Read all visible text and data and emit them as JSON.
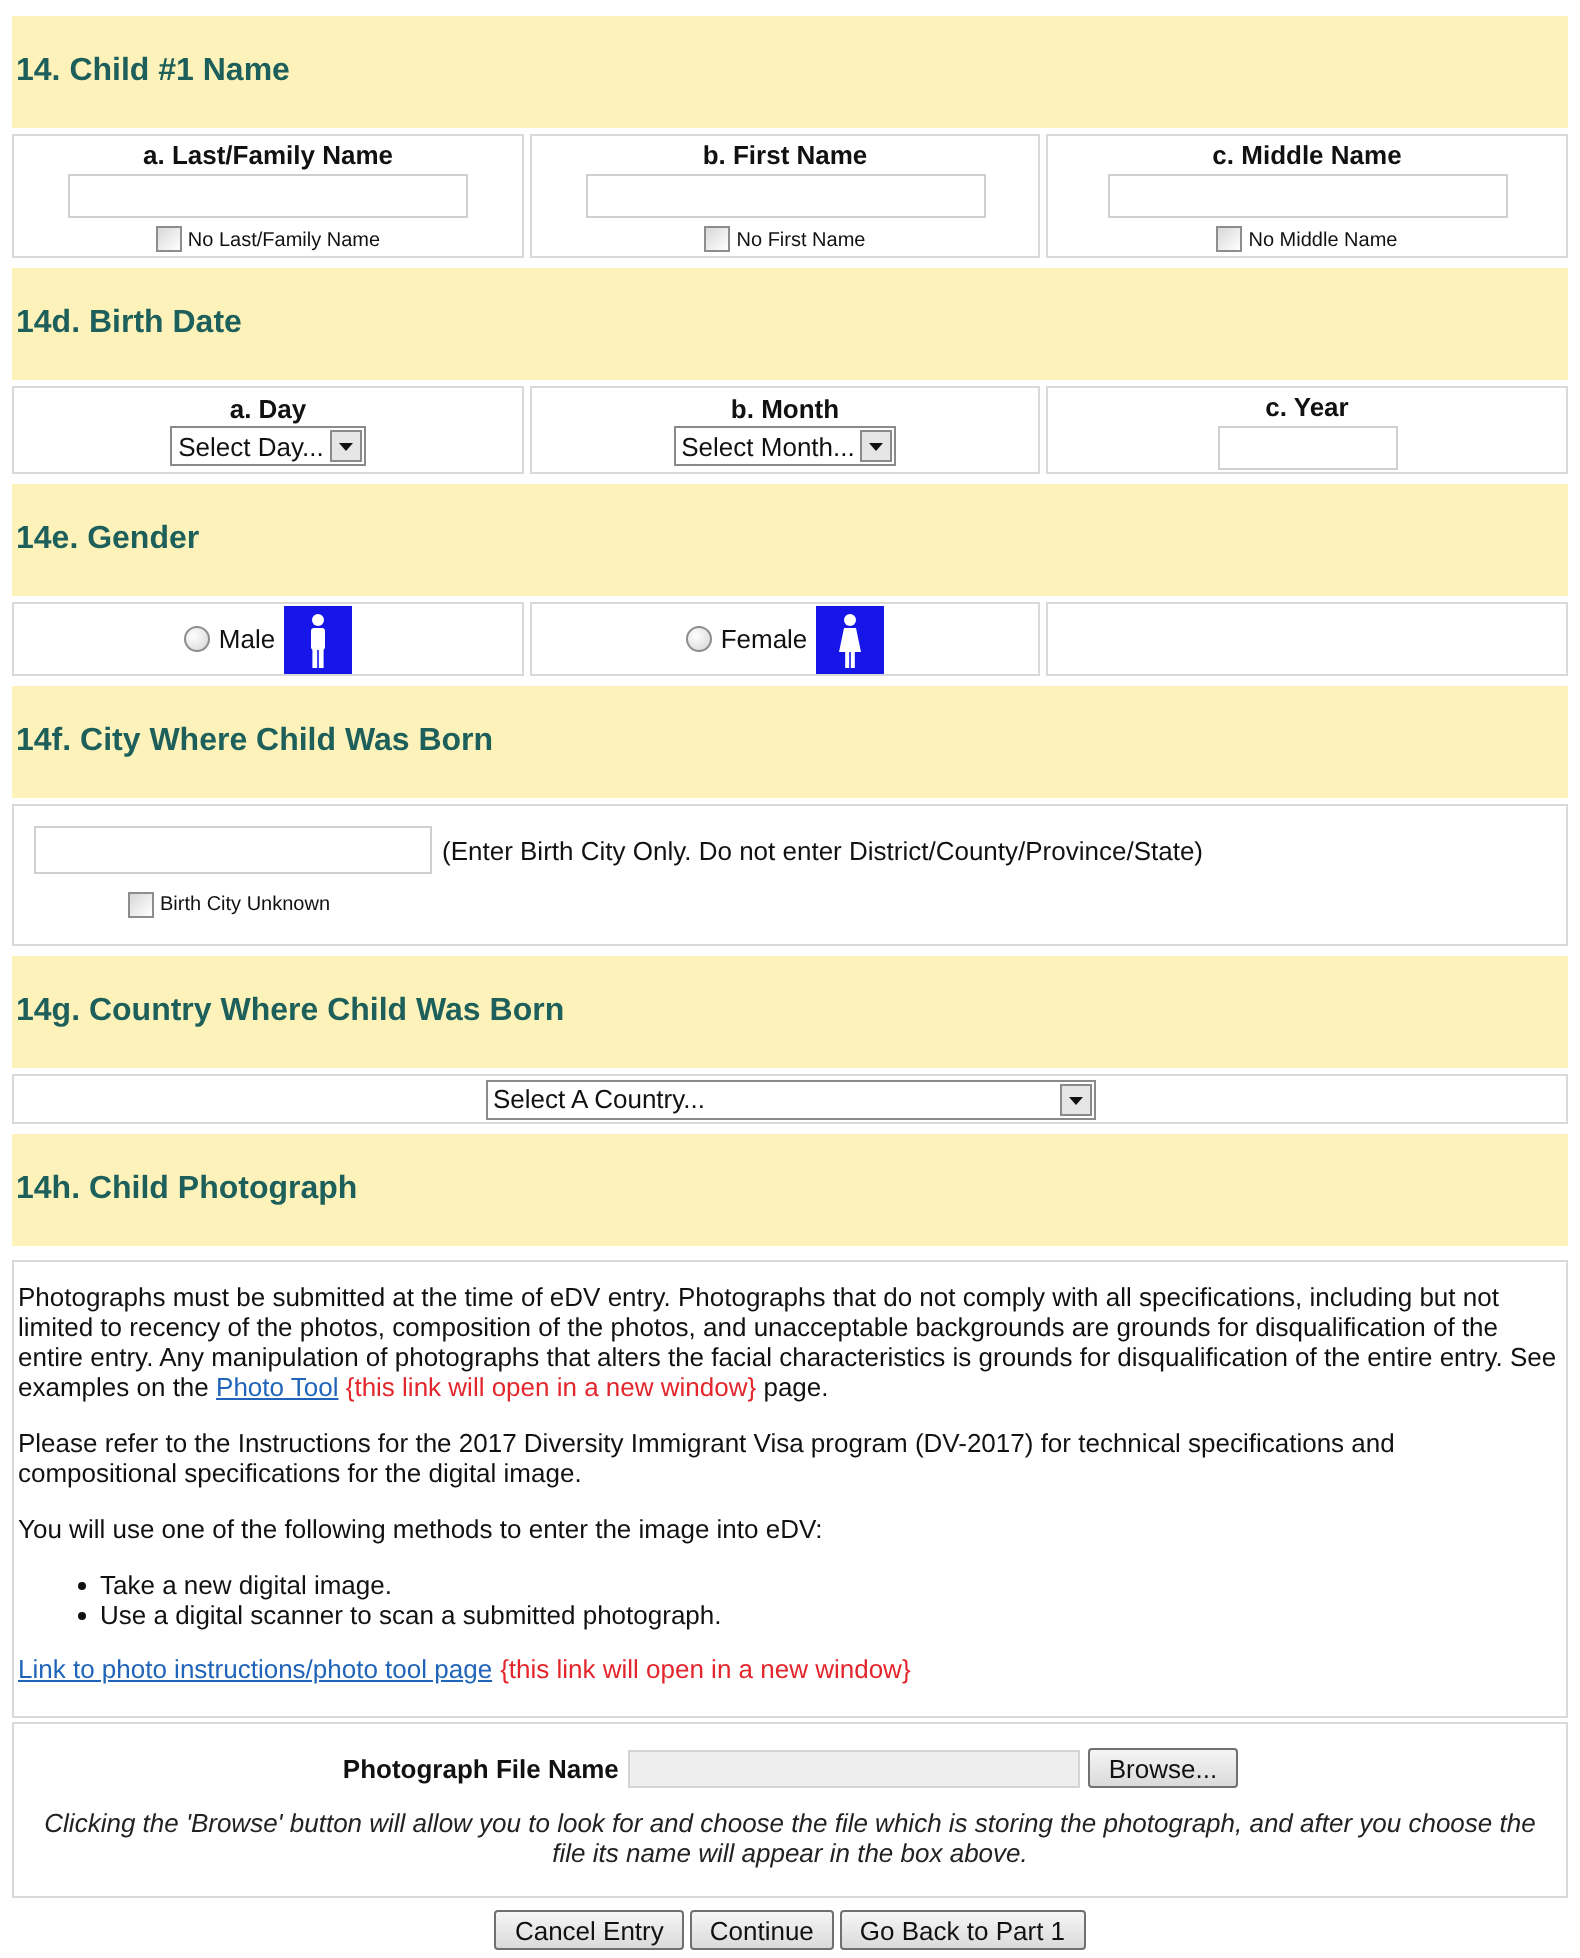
{
  "sections": [
    {
      "kind": "name",
      "title": "14. Child #1 Name",
      "fields": [
        {
          "label": "a. Last/Family Name",
          "checkbox": {
            "label": "No Last/Family Name",
            "checked": false
          }
        },
        {
          "label": "b. First Name",
          "checkbox": {
            "label": "No First Name",
            "checked": false
          }
        },
        {
          "label": "c. Middle Name",
          "checkbox": {
            "label": "No Middle Name",
            "checked": false
          }
        }
      ]
    },
    {
      "kind": "date",
      "title": "14d. Birth Date",
      "fields": [
        {
          "kind": "select",
          "label": "a. Day",
          "value": "Select Day..."
        },
        {
          "kind": "select",
          "label": "b. Month",
          "value": "Select Month..."
        },
        {
          "kind": "text",
          "label": "c. Year"
        }
      ]
    },
    {
      "kind": "gender",
      "title": "14e. Gender",
      "options": [
        {
          "kind": "male",
          "label": "Male",
          "selected": false
        },
        {
          "kind": "female",
          "label": "Female",
          "selected": false
        }
      ]
    },
    {
      "kind": "city",
      "title": "14f. City Where Child Was Born",
      "note": "(Enter Birth City Only. Do not enter District/County/Province/State)",
      "checkbox": {
        "label": "Birth City Unknown",
        "checked": false
      }
    },
    {
      "kind": "country",
      "title": "14g. Country Where Child Was Born",
      "value": "Select A Country..."
    },
    {
      "kind": "photo",
      "title": "14h. Child Photograph",
      "body": [
        {
          "kind": "paragraph",
          "parts": [
            {
              "kind": "text",
              "text": "Photographs must be submitted at the time of eDV entry. Photographs that do not comply with all specifications, including but not limited to recency of the photos, composition of the photos, and unacceptable backgrounds are grounds for disqualification of the entire entry. Any manipulation of photographs that alters the facial characteristics is grounds for disqualification of the entire entry. See examples on the"
            },
            {
              "kind": "link",
              "text": "Photo Tool"
            },
            {
              "kind": "note",
              "text": "{this link will open in a new window}"
            },
            {
              "kind": "text",
              "text": "page."
            }
          ]
        },
        {
          "kind": "paragraph",
          "parts": [
            {
              "kind": "text",
              "text": "Please refer to the Instructions for the 2017 Diversity Immigrant Visa program (DV-2017) for technical specifications and compositional specifications for the digital image."
            }
          ]
        },
        {
          "kind": "paragraph",
          "parts": [
            {
              "kind": "text",
              "text": "You will use one of the following methods to enter the image into eDV:"
            }
          ]
        },
        {
          "kind": "list",
          "items": [
            "Take a new digital image.",
            "Use a digital scanner to scan a submitted photograph."
          ]
        },
        {
          "kind": "link_line",
          "link": "Link to photo instructions/photo tool page",
          "note": "{this link will open in a new window}"
        }
      ],
      "upload": {
        "label": "Photograph File Name",
        "button": "Browse...",
        "help": "Clicking the 'Browse' button will allow you to look for and choose the file which is storing the photograph, and after you choose the file its name will appear in the box above."
      }
    }
  ],
  "buttons": [
    "Cancel Entry",
    "Continue",
    "Go Back to Part 1"
  ]
}
